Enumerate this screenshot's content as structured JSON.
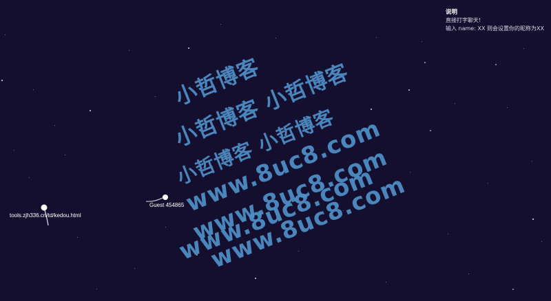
{
  "instructions": {
    "title": "说明",
    "lines": [
      "直接打字聊天!",
      "输入 name: XX 则会设置你的昵称为XX"
    ]
  },
  "players": [
    {
      "name": "Guest 454865"
    },
    {
      "name": "tools.zjh336.cn/td/kedou.html"
    }
  ],
  "watermark": {
    "chinese": [
      "小哲博客",
      "小哲博客 小哲博客",
      "小哲博客 小哲博客 小哲博客",
      "小哲博客 小哲博客"
    ],
    "urls": [
      "www.8uc8.com",
      "www.8uc8.com",
      "www.8uc8.com",
      "www.8uc8.com"
    ]
  },
  "colors": {
    "background": "#140f2e",
    "watermark": "#4f8fc7",
    "text": "#ffffff"
  }
}
